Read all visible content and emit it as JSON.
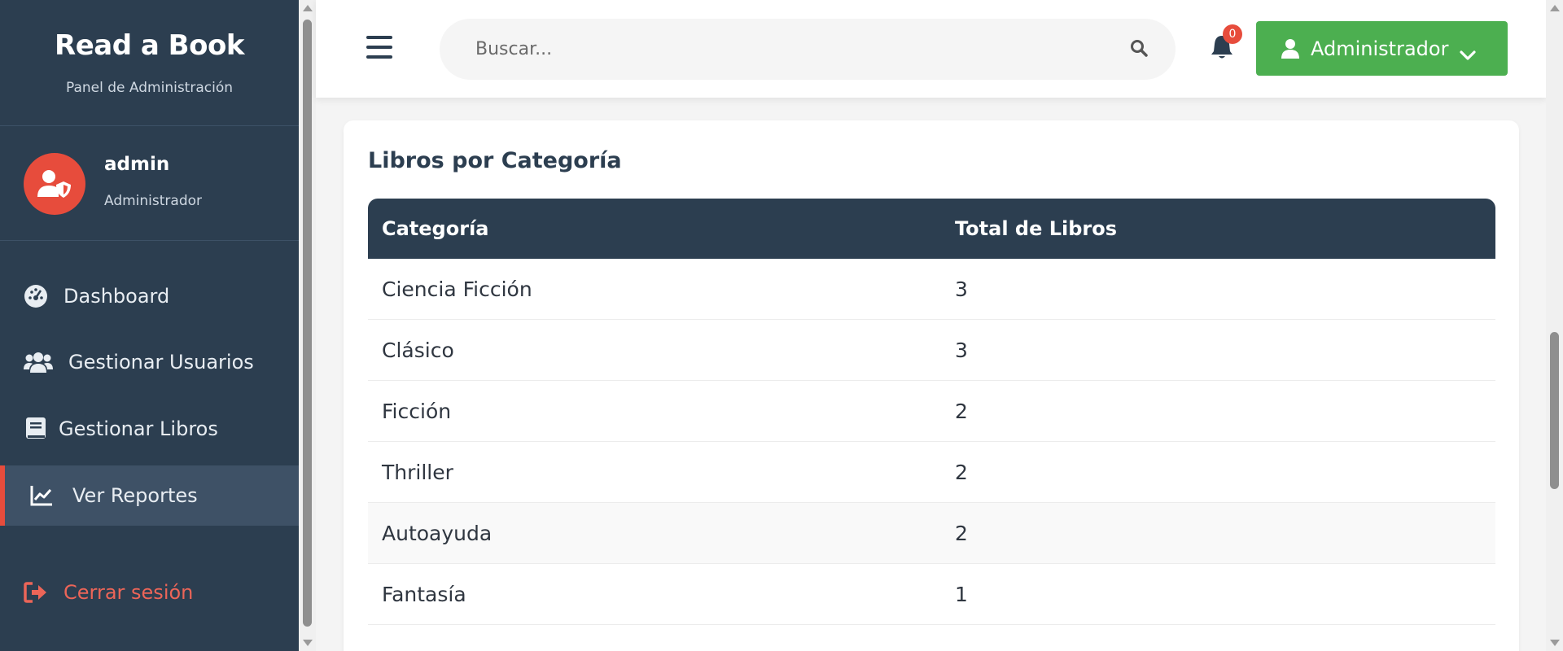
{
  "brand": {
    "title": "Read a Book",
    "subtitle": "Panel de Administración"
  },
  "user": {
    "name": "admin",
    "role": "Administrador",
    "avatar_icon": "user-shield-icon"
  },
  "nav": [
    {
      "label": "Dashboard",
      "icon": "dashboard-gauge-icon"
    },
    {
      "label": "Gestionar Usuarios",
      "icon": "users-icon"
    },
    {
      "label": "Gestionar Libros",
      "icon": "book-icon"
    },
    {
      "label": "Ver Reportes",
      "icon": "chart-line-icon",
      "active": true
    }
  ],
  "logout": {
    "label": "Cerrar sesión",
    "icon": "sign-out-icon"
  },
  "topbar": {
    "search_placeholder": "Buscar...",
    "notification_count": "0",
    "account_label": "Administrador"
  },
  "report": {
    "title": "Libros por Categoría",
    "columns": [
      "Categoría",
      "Total de Libros"
    ],
    "rows": [
      {
        "category": "Ciencia Ficción",
        "total": "3"
      },
      {
        "category": "Clásico",
        "total": "3"
      },
      {
        "category": "Ficción",
        "total": "2"
      },
      {
        "category": "Thriller",
        "total": "2"
      },
      {
        "category": "Autoayuda",
        "total": "2"
      },
      {
        "category": "Fantasía",
        "total": "1"
      }
    ]
  },
  "colors": {
    "sidebar": "#2c3e50",
    "accent_red": "#e74c3c",
    "account_green": "#4caf50"
  }
}
